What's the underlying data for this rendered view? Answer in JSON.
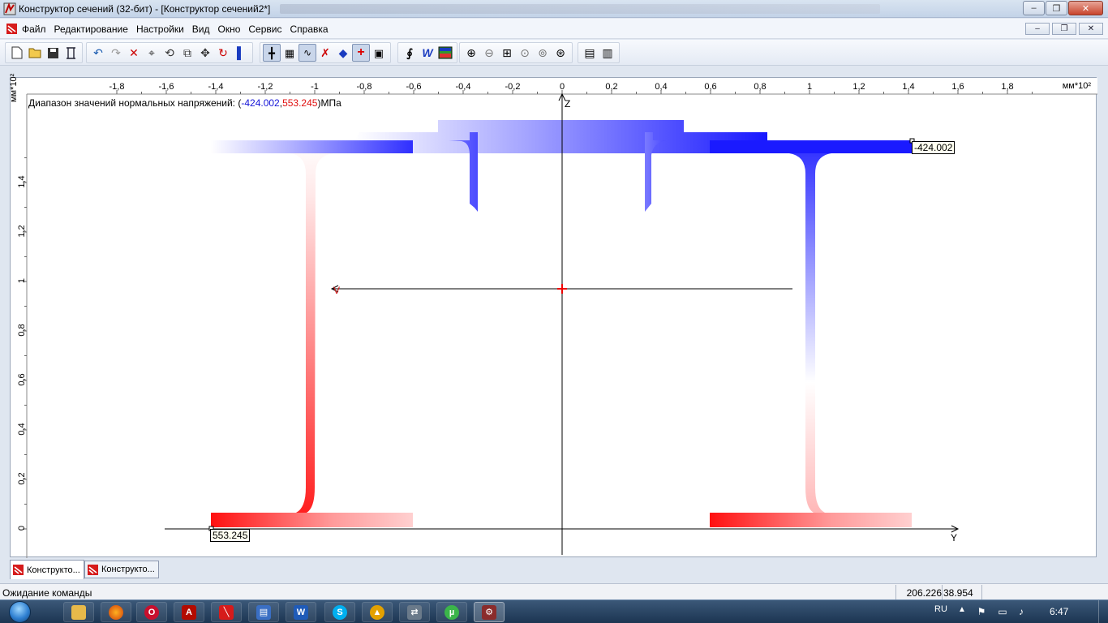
{
  "window": {
    "title": "Конструктор сечений (32-бит) - [Конструктор сечений2*]",
    "controls": {
      "minimize": "–",
      "maximize": "❐",
      "close": "✕"
    }
  },
  "menu": {
    "items": [
      "Файл",
      "Редактирование",
      "Настройки",
      "Вид",
      "Окно",
      "Сервис",
      "Справка"
    ],
    "mdi_controls": {
      "minimize": "–",
      "restore": "❐",
      "close": "✕"
    }
  },
  "toolbar": {
    "groups": [
      [
        "new-file-icon",
        "open-folder-icon",
        "save-icon",
        "page-setup-icon"
      ],
      [
        "undo-icon",
        "redo-icon",
        "delete-icon",
        "snap-node-icon",
        "rotate-node-icon",
        "copy-icon",
        "move-icon",
        "rotate-icon",
        "mirror-icon"
      ],
      [
        "axes-icon",
        "grid-icon",
        "trace-icon",
        "crosshair-off-icon",
        "point-icon",
        "center-mark-icon",
        "calculator-icon"
      ],
      [
        "clip-icon",
        "word-export-icon",
        "stress-map-icon"
      ],
      [
        "zoom-in-icon",
        "zoom-out-icon",
        "zoom-window-icon",
        "zoom-prev-icon",
        "zoom-all-icon",
        "zoom-fit-icon"
      ],
      [
        "properties-icon",
        "report-icon"
      ]
    ]
  },
  "drawing": {
    "range_label_prefix": "Диапазон значений нормальных напряжений: (",
    "range_min": "-424.002",
    "range_sep": ",",
    "range_max": "553.245",
    "range_label_suffix": ")МПа",
    "unit_x": "мм*10²",
    "unit_y": "мм*10²",
    "axis_z": "Z",
    "axis_y": "Y",
    "axis_v": "V",
    "callout_max": "553.245",
    "callout_min": "-424.002",
    "x_ticks": [
      "-1,8",
      "-1,6",
      "-1,4",
      "-1,2",
      "-1",
      "-0,8",
      "-0,6",
      "-0,4",
      "-0,2",
      "0",
      "0,2",
      "0,4",
      "0,6",
      "0,8",
      "1",
      "1,2",
      "1,4",
      "1,6",
      "1,8"
    ],
    "y_ticks": [
      "0",
      "0,2",
      "0,4",
      "0,6",
      "0,8",
      "1",
      "1,2",
      "1,4"
    ],
    "colors": {
      "tension": "#ff1010",
      "compression": "#1010ff"
    }
  },
  "tabs": [
    "Конструкто...",
    "Конструкто..."
  ],
  "status": {
    "message": "Ожидание команды",
    "x": "206.226",
    "y": "38.954"
  },
  "taskbar": {
    "apps": [
      "explorer",
      "firefox",
      "opera",
      "acrobat",
      "section-designer",
      "file-manager",
      "word",
      "skype",
      "winamp",
      "network-tool",
      "utorrent",
      "section-designer-active"
    ],
    "language": "RU",
    "time": "6:47"
  }
}
